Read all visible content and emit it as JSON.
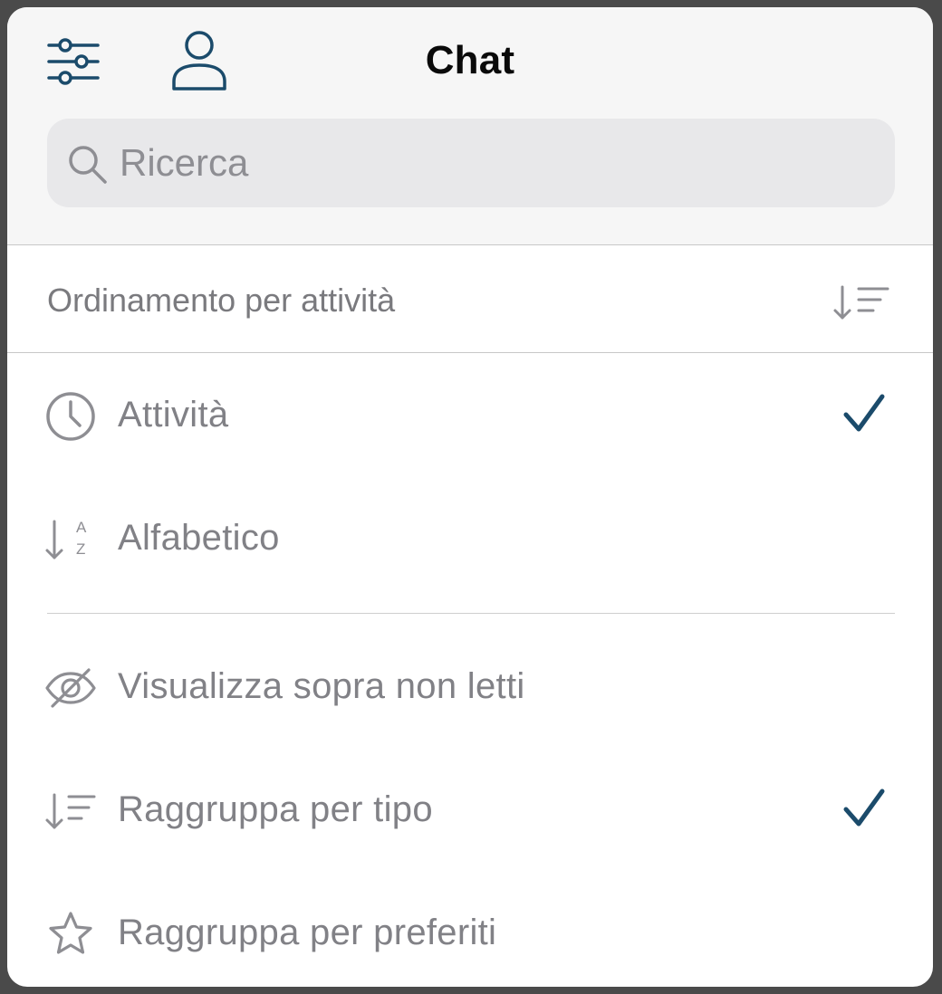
{
  "header": {
    "title": "Chat",
    "filter_icon": "sliders-icon",
    "profile_icon": "user-icon"
  },
  "search": {
    "placeholder": "Ricerca",
    "value": "",
    "icon": "search-icon"
  },
  "sort_section": {
    "label": "Ordinamento per attività",
    "icon": "sort-descending-icon"
  },
  "sort_options": [
    {
      "label": "Attività",
      "icon": "clock-icon",
      "checked": true
    },
    {
      "label": "Alfabetico",
      "icon": "sort-alphabetical-icon",
      "checked": false
    }
  ],
  "display_options": [
    {
      "label": "Visualizza sopra non letti",
      "icon": "eye-slash-icon",
      "checked": false
    },
    {
      "label": "Raggruppa per tipo",
      "icon": "sort-descending-icon",
      "checked": true
    },
    {
      "label": "Raggruppa per preferiti",
      "icon": "star-icon",
      "checked": false
    }
  ],
  "colors": {
    "accent": "#1b4b6b",
    "label_gray": "#818186",
    "header_bg": "#f6f6f6",
    "search_bg": "#e8e8ea"
  }
}
